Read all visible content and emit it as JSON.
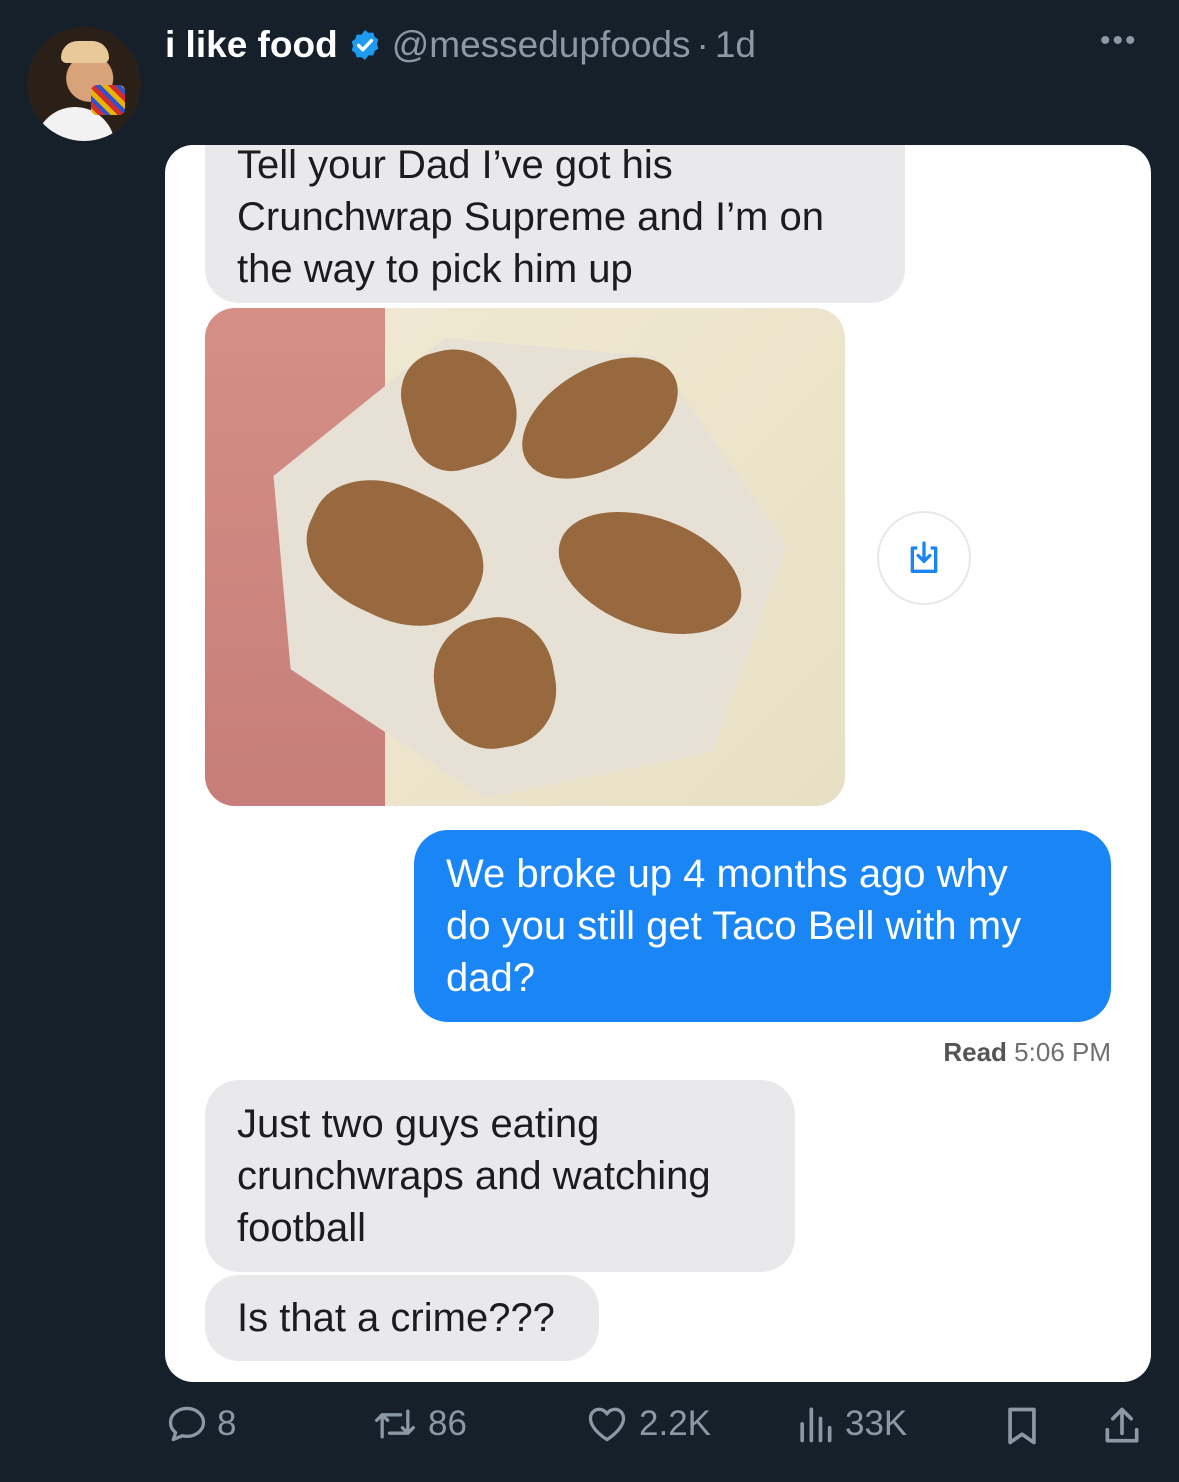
{
  "post": {
    "display_name": "i like food",
    "handle": "@messedupfoods",
    "separator": "·",
    "age": "1d",
    "more_label": "•••"
  },
  "messages": {
    "incoming_1": "Tell your Dad I’ve got his\nCrunchwrap Supreme and I’m on\nthe way to pick him up",
    "outgoing_1": "We broke up 4 months ago why\ndo you still get Taco Bell with my\ndad?",
    "read_label": "Read",
    "read_time": "5:06 PM",
    "incoming_2": "Just two guys eating\ncrunchwraps and watching\nfootball",
    "incoming_3": "Is that a crime???"
  },
  "actions": {
    "replies": "8",
    "reposts": "86",
    "likes": "2.2K",
    "views": "33K"
  },
  "icons": [
    "verified-badge-icon",
    "more-icon",
    "download-icon",
    "reply-icon",
    "repost-icon",
    "like-icon",
    "views-icon",
    "bookmark-icon",
    "share-icon"
  ],
  "colors": {
    "background": "#15202b",
    "accent": "#1d9bf0",
    "muted": "#8b98a5",
    "imessage_blue": "#1a86f5"
  }
}
